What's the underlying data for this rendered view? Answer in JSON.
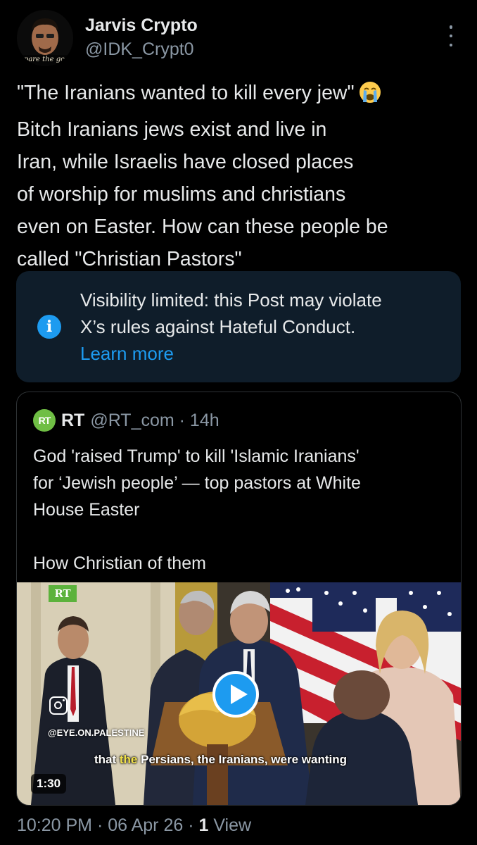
{
  "post": {
    "author": {
      "name": "Jarvis Crypto",
      "handle": "@IDK_Crypt0",
      "avatar_caption": "epare the go"
    },
    "text_lines": [
      "\"The Iranians wanted to kill every jew\"",
      "Bitch Iranians jews exist and live in",
      "Iran, while Israelis have closed places",
      "of worship for muslims and christians",
      "even on Easter. How can these people be",
      "called \"Christian Pastors\""
    ],
    "emoji": "loudly-crying-face"
  },
  "notice": {
    "icon": "info-icon",
    "lines": [
      "Visibility limited: this Post may violate",
      "X’s rules against Hateful Conduct."
    ],
    "link_label": "Learn more"
  },
  "quote": {
    "logo_text": "RT",
    "name": "RT",
    "handle_time": "@RT_com · 14h",
    "text_lines": [
      "God 'raised Trump' to kill 'Islamic Iranians'",
      "for ‘Jewish people’ — top pastors at White",
      "House Easter"
    ],
    "text_line_after_gap": "How Christian of them",
    "video": {
      "channel_watermark": "RT",
      "instagram_handle": "@EYE.ON.PALESTINE",
      "subtitle_before": "that ",
      "subtitle_highlight": "the",
      "subtitle_after": " Persians, the Iranians, were wanting",
      "duration": "1:30"
    }
  },
  "footer": {
    "timestamp": "10:20 PM · 06 Apr 26 · ",
    "views_count": "1",
    "views_label": " View"
  },
  "colors": {
    "background": "#000000",
    "text": "#e7e9ea",
    "secondary_text": "#8b98a5",
    "accent": "#1d9bf0",
    "notice_bg": "#0f1d2a",
    "border": "#2f3336",
    "rt_green": "#6fbe44"
  }
}
